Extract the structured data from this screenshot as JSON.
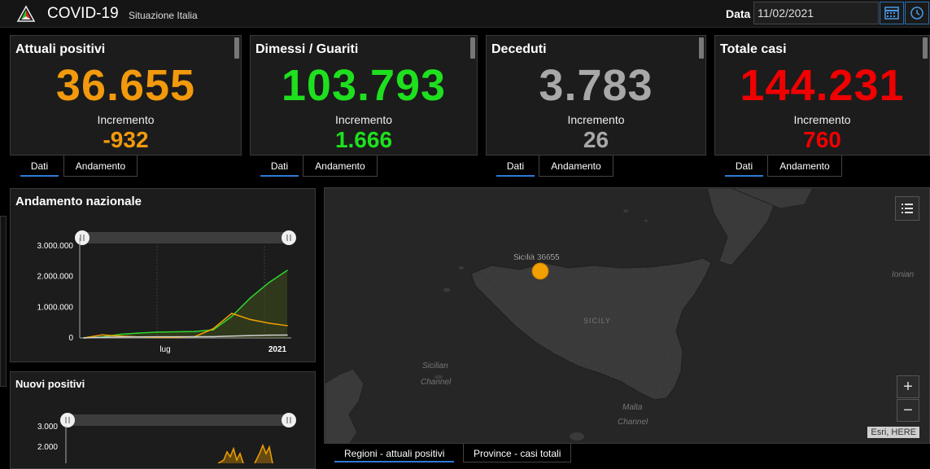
{
  "header": {
    "title": "COVID-19",
    "subtitle": "Situazione Italia",
    "date_label": "Data",
    "date_value": "11/02/2021"
  },
  "cards": [
    {
      "title": "Attuali positivi",
      "value": "36.655",
      "increment_label": "Incremento",
      "increment": "-932",
      "color": "#f29a0c"
    },
    {
      "title": "Dimessi / Guariti",
      "value": "103.793",
      "increment_label": "Incremento",
      "increment": "1.666",
      "color": "#1ee01e"
    },
    {
      "title": "Deceduti",
      "value": "3.783",
      "increment_label": "Incremento",
      "increment": "26",
      "color": "#a8a8a8"
    },
    {
      "title": "Totale casi",
      "value": "144.231",
      "increment_label": "Incremento",
      "increment": "760",
      "color": "#f00000"
    }
  ],
  "card_tabs": {
    "data": "Dati",
    "trend": "Andamento"
  },
  "trend_panel": {
    "title": "Andamento nazionale",
    "y_ticks": [
      "3.000.000",
      "2.000.000",
      "1.000.000",
      "0"
    ],
    "x_ticks": [
      "lug",
      "2021"
    ]
  },
  "new_positive_panel": {
    "title": "Nuovi positivi",
    "y_ticks": [
      "3.000",
      "2.000"
    ]
  },
  "map": {
    "label_sicily": "SICILY",
    "label_channel": "Sicilian Channel",
    "label_malta": "Malta Channel",
    "label_ionian": "Ionian",
    "point_label": "Sicilia 36655",
    "attribution": "Esri, HERE",
    "zoom_in": "+",
    "zoom_out": "−",
    "tabs": [
      "Regioni - attuali positivi",
      "Province - casi totali"
    ]
  },
  "chart_data": [
    {
      "type": "line",
      "title": "Andamento nazionale",
      "x": [
        "2020-03",
        "2020-04",
        "2020-05",
        "2020-06",
        "2020-07",
        "2020-08",
        "2020-09",
        "2020-10",
        "2020-11",
        "2020-12",
        "2021-01",
        "2021-02"
      ],
      "series": [
        {
          "color": "#2fd62f",
          "values": [
            0,
            30000,
            120000,
            160000,
            190000,
            200000,
            210000,
            260000,
            700000,
            1300000,
            1800000,
            2200000
          ]
        },
        {
          "color": "#f2a000",
          "values": [
            0,
            100000,
            60000,
            30000,
            15000,
            18000,
            40000,
            300000,
            800000,
            600000,
            480000,
            400000
          ]
        },
        {
          "color": "#cfcfcf",
          "values": [
            0,
            20000,
            30000,
            34000,
            35000,
            35000,
            36000,
            40000,
            60000,
            75000,
            88000,
            93000
          ]
        }
      ],
      "ylim": [
        0,
        3000000
      ]
    }
  ],
  "colors": {
    "accent": "#2d7ad6",
    "point": "#f2a000"
  }
}
